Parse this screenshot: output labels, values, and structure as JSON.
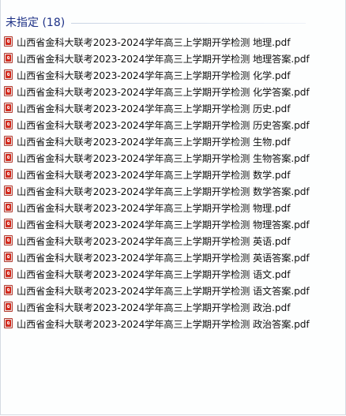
{
  "group": {
    "title": "未指定 (18)"
  },
  "files": [
    {
      "name": "山西省金科大联考2023-2024学年高三上学期开学检测 地理.pdf",
      "icon": "pdf-icon"
    },
    {
      "name": "山西省金科大联考2023-2024学年高三上学期开学检测 地理答案.pdf",
      "icon": "pdf-icon"
    },
    {
      "name": "山西省金科大联考2023-2024学年高三上学期开学检测 化学.pdf",
      "icon": "pdf-icon"
    },
    {
      "name": "山西省金科大联考2023-2024学年高三上学期开学检测 化学答案.pdf",
      "icon": "pdf-icon"
    },
    {
      "name": "山西省金科大联考2023-2024学年高三上学期开学检测 历史.pdf",
      "icon": "pdf-icon"
    },
    {
      "name": "山西省金科大联考2023-2024学年高三上学期开学检测 历史答案.pdf",
      "icon": "pdf-icon"
    },
    {
      "name": "山西省金科大联考2023-2024学年高三上学期开学检测 生物.pdf",
      "icon": "pdf-icon"
    },
    {
      "name": "山西省金科大联考2023-2024学年高三上学期开学检测 生物答案.pdf",
      "icon": "pdf-icon"
    },
    {
      "name": "山西省金科大联考2023-2024学年高三上学期开学检测 数学.pdf",
      "icon": "pdf-icon"
    },
    {
      "name": "山西省金科大联考2023-2024学年高三上学期开学检测 数学答案.pdf",
      "icon": "pdf-icon"
    },
    {
      "name": "山西省金科大联考2023-2024学年高三上学期开学检测 物理.pdf",
      "icon": "pdf-icon"
    },
    {
      "name": "山西省金科大联考2023-2024学年高三上学期开学检测 物理答案.pdf",
      "icon": "pdf-icon"
    },
    {
      "name": "山西省金科大联考2023-2024学年高三上学期开学检测 英语.pdf",
      "icon": "pdf-icon"
    },
    {
      "name": "山西省金科大联考2023-2024学年高三上学期开学检测 英语答案.pdf",
      "icon": "pdf-icon"
    },
    {
      "name": "山西省金科大联考2023-2024学年高三上学期开学检测 语文.pdf",
      "icon": "pdf-icon"
    },
    {
      "name": "山西省金科大联考2023-2024学年高三上学期开学检测 语文答案.pdf",
      "icon": "pdf-icon"
    },
    {
      "name": "山西省金科大联考2023-2024学年高三上学期开学检测 政治.pdf",
      "icon": "pdf-icon"
    },
    {
      "name": "山西省金科大联考2023-2024学年高三上学期开学检测 政治答案.pdf",
      "icon": "pdf-icon"
    }
  ],
  "colors": {
    "group_title": "#1e3287",
    "pdf_red": "#d42b1e",
    "text": "#111111"
  }
}
